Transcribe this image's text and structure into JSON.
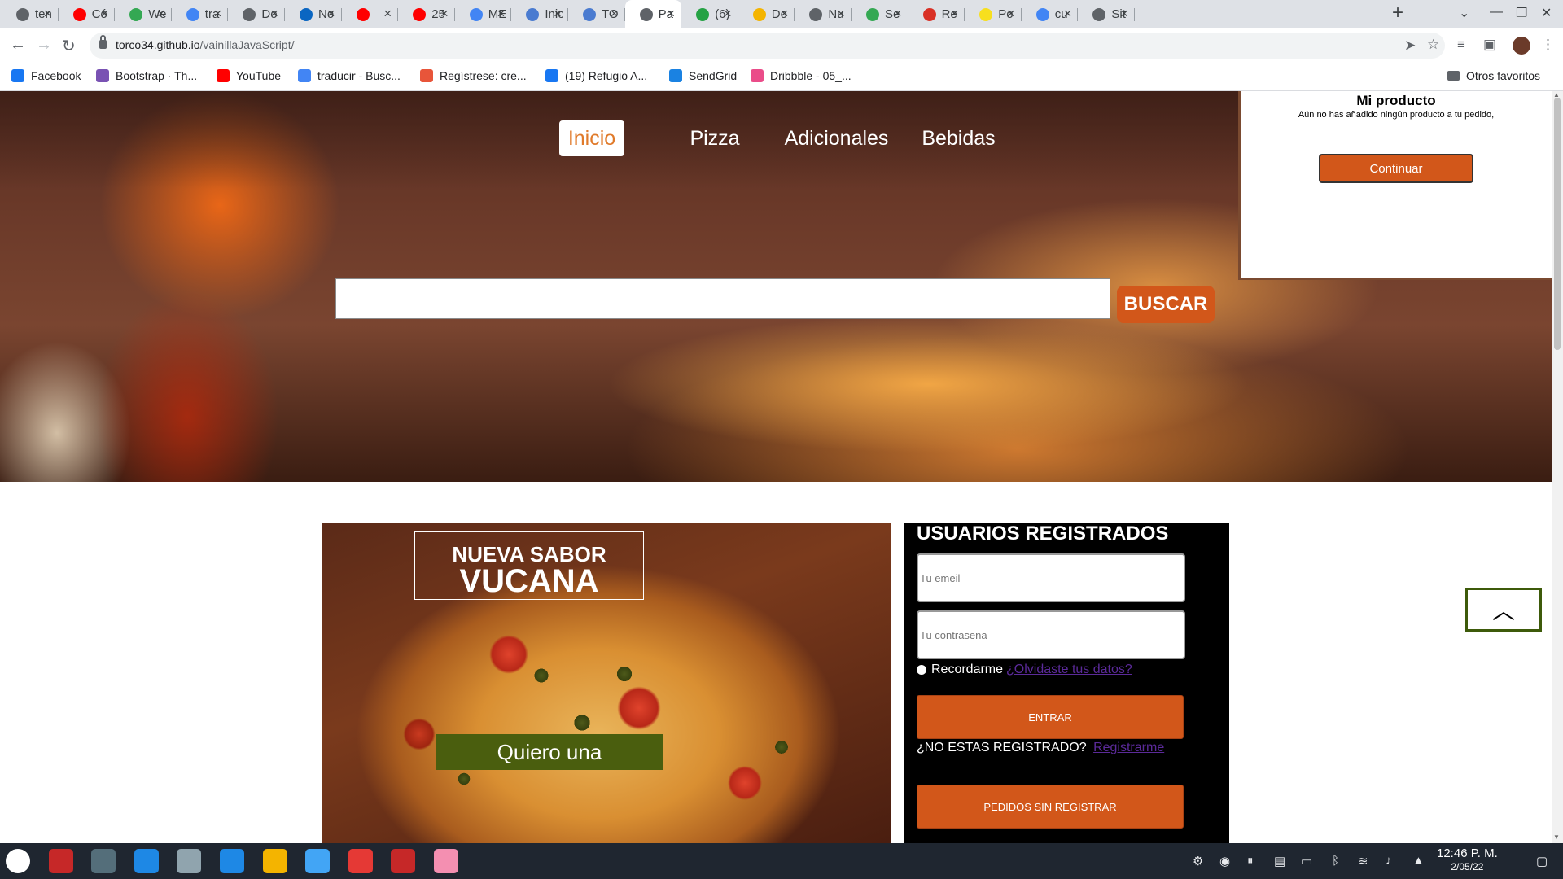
{
  "browser": {
    "tabs": [
      {
        "label": "ten",
        "color": "#5f6368"
      },
      {
        "label": "Có",
        "color": "#ff0000"
      },
      {
        "label": "We",
        "color": "#34a853"
      },
      {
        "label": "tra",
        "color": "#4285f4"
      },
      {
        "label": "Do",
        "color": "#5f6368"
      },
      {
        "label": "No",
        "color": "#0a66c2"
      },
      {
        "label": "",
        "color": "#ff0000"
      },
      {
        "label": "25",
        "color": "#ff0000"
      },
      {
        "label": "ME",
        "color": "#4285f4"
      },
      {
        "label": "Inic",
        "color": "#4a7bd0"
      },
      {
        "label": "TO",
        "color": "#4a7bd0"
      },
      {
        "label": "Pa",
        "color": "#5f6368",
        "active": true
      },
      {
        "label": "(6)",
        "color": "#25a244"
      },
      {
        "label": "Do",
        "color": "#f4b400"
      },
      {
        "label": "Nu",
        "color": "#5f6368"
      },
      {
        "label": "Se",
        "color": "#34a853"
      },
      {
        "label": "Re",
        "color": "#d93025"
      },
      {
        "label": "Po",
        "color": "#f7df1e"
      },
      {
        "label": "cu",
        "color": "#4285f4"
      },
      {
        "label": "Sit",
        "color": "#5f6368"
      }
    ],
    "new_tab": "+",
    "url_host": "torco34.github.io",
    "url_path": "/vainillaJavaScript/",
    "bookmarks": [
      {
        "label": "Facebook",
        "color": "#1877f2"
      },
      {
        "label": "Bootstrap · Th...",
        "color": "#7952b3"
      },
      {
        "label": "YouTube",
        "color": "#ff0000"
      },
      {
        "label": "traducir - Busc...",
        "color": "#4285f4"
      },
      {
        "label": "Regístrese: cre...",
        "color": "#e8553a"
      },
      {
        "label": "(19) Refugio A...",
        "color": "#1877f2"
      },
      {
        "label": "SendGrid",
        "color": "#1a82e2"
      },
      {
        "label": "Dribbble - 05_...",
        "color": "#ea4c89"
      }
    ],
    "other_bookmarks": "Otros favoritos"
  },
  "nav": {
    "items": [
      "Inicio",
      "Pizza",
      "Adicionales",
      "Bebidas"
    ],
    "active": "Inicio"
  },
  "search": {
    "value": "",
    "button": "BUSCAR"
  },
  "cart": {
    "title": "Mi producto",
    "message": "Aún no has añadido ningún producto a tu pedido,",
    "button": "Continuar"
  },
  "promo": {
    "subtitle": "NUEVA SABOR",
    "title": "VUCANA",
    "button": "Quiero una"
  },
  "login": {
    "title": "USUARIOS REGISTRADOS",
    "email_placeholder": "Tu emeil",
    "password_placeholder": "Tu contrasena",
    "remember": "Recordarme",
    "forgot": "¿Olvidaste tus datos?",
    "submit": "ENTRAR",
    "not_registered": "¿NO ESTAS REGISTRADO?",
    "register": "Registrarme",
    "guest": "PEDIDOS SIN REGISTRAR"
  },
  "taskbar": {
    "apps": [
      {
        "name": "settings-app",
        "color": "#ffffff"
      },
      {
        "name": "terminal-app-1",
        "color": "#c62828"
      },
      {
        "name": "mixer-app",
        "color": "#546e7a"
      },
      {
        "name": "store-app",
        "color": "#1e88e5"
      },
      {
        "name": "screenshot-app",
        "color": "#90a4ae"
      },
      {
        "name": "vscode-app",
        "color": "#1e88e5"
      },
      {
        "name": "chrome-app",
        "color": "#f4b400"
      },
      {
        "name": "files-app",
        "color": "#42a5f5"
      },
      {
        "name": "ide-app",
        "color": "#e53935"
      },
      {
        "name": "terminal-app-2",
        "color": "#c62828"
      },
      {
        "name": "screen-recorder-app",
        "color": "#f48fb1"
      }
    ],
    "time": "12:46 P. M.",
    "date": "2/05/22"
  }
}
